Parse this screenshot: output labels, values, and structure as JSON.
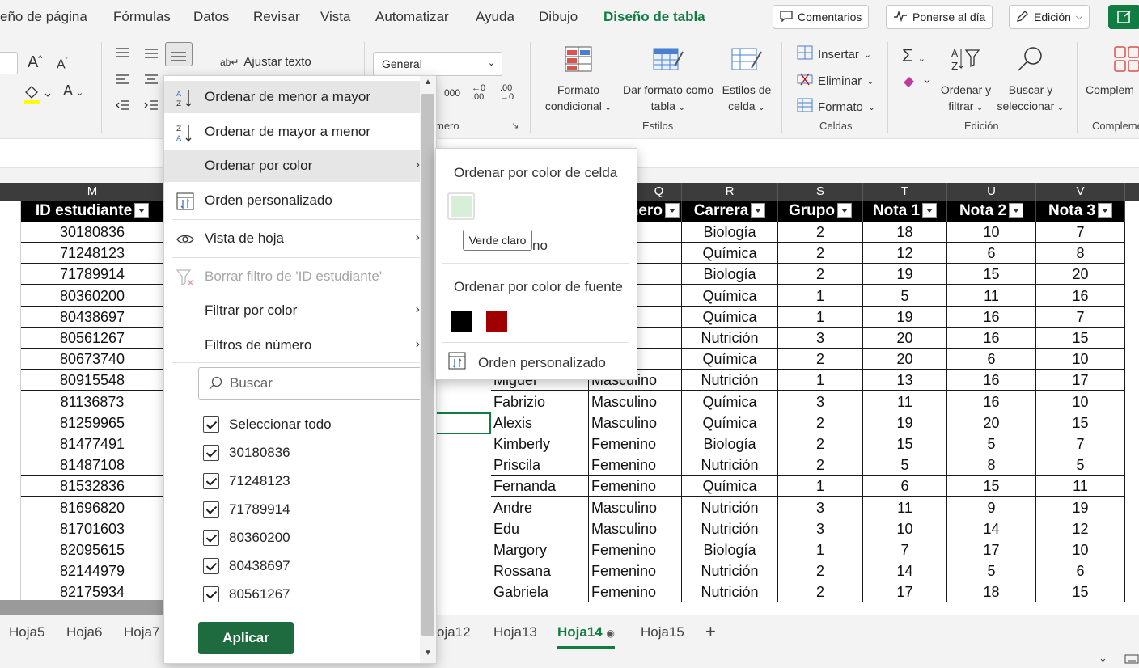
{
  "menu": {
    "tabs": [
      "eño de página",
      "Fórmulas",
      "Datos",
      "Revisar",
      "Vista",
      "Automatizar",
      "Ayuda",
      "Dibujo",
      "Diseño de tabla"
    ],
    "active_tab": "Diseño de tabla",
    "comments": "Comentarios",
    "catch_up": "Ponerse al día",
    "editing": "Edición"
  },
  "ribbon": {
    "wrap_text": "Ajustar texto",
    "number_format": "General",
    "group_numero": "mero",
    "conditional_format": [
      "Formato",
      "condicional"
    ],
    "format_as_table": [
      "Dar formato como",
      "tabla"
    ],
    "cell_styles": [
      "Estilos de",
      "celda"
    ],
    "group_styles": "Estilos",
    "insert": "Insertar",
    "delete": "Eliminar",
    "format": "Formato",
    "group_cells": "Celdas",
    "sort_filter": [
      "Ordenar y",
      "filtrar"
    ],
    "find_select": [
      "Buscar y",
      "seleccionar"
    ],
    "group_edit": "Edición",
    "complements": "Complem",
    "group_complements": "Compleme"
  },
  "grid": {
    "columns": [
      "M",
      "Q",
      "R",
      "S",
      "T",
      "U",
      "V"
    ],
    "headers": {
      "id": "ID estudiante",
      "genero": "nero",
      "carrera": "Carrera",
      "grupo": "Grupo",
      "nota1": "Nota 1",
      "nota2": "Nota 2",
      "nota3": "Nota 3"
    },
    "rows": [
      {
        "id": "30180836",
        "nombre": "",
        "genero": "sculino",
        "carrera": "Biología",
        "grupo": "2",
        "n1": "18",
        "n2": "10",
        "n3": "7"
      },
      {
        "id": "71248123",
        "nombre": "",
        "genero": "sculino",
        "carrera": "Química",
        "grupo": "2",
        "n1": "12",
        "n2": "6",
        "n3": "8"
      },
      {
        "id": "71789914",
        "nombre": "",
        "genero": "sculino",
        "carrera": "Biología",
        "grupo": "2",
        "n1": "19",
        "n2": "15",
        "n3": "20"
      },
      {
        "id": "80360200",
        "nombre": "",
        "genero": "enino",
        "carrera": "Química",
        "grupo": "1",
        "n1": "5",
        "n2": "11",
        "n3": "16"
      },
      {
        "id": "80438697",
        "nombre": "",
        "genero": "enino",
        "carrera": "Química",
        "grupo": "1",
        "n1": "19",
        "n2": "16",
        "n3": "7"
      },
      {
        "id": "80561267",
        "nombre": "",
        "genero": "sculino",
        "carrera": "Nutrición",
        "grupo": "3",
        "n1": "20",
        "n2": "16",
        "n3": "15"
      },
      {
        "id": "80673740",
        "nombre": "",
        "genero": "sculino",
        "carrera": "Química",
        "grupo": "2",
        "n1": "20",
        "n2": "6",
        "n3": "10"
      },
      {
        "id": "80915548",
        "nombre": "Miguel",
        "genero": "Masculino",
        "carrera": "Nutrición",
        "grupo": "1",
        "n1": "13",
        "n2": "16",
        "n3": "17"
      },
      {
        "id": "81136873",
        "nombre": "Fabrizio",
        "genero": "Masculino",
        "carrera": "Química",
        "grupo": "3",
        "n1": "11",
        "n2": "16",
        "n3": "10"
      },
      {
        "id": "81259965",
        "nombre": "Alexis",
        "genero": "Masculino",
        "carrera": "Química",
        "grupo": "2",
        "n1": "19",
        "n2": "20",
        "n3": "15"
      },
      {
        "id": "81477491",
        "nombre": "Kimberly",
        "genero": "Femenino",
        "carrera": "Biología",
        "grupo": "2",
        "n1": "15",
        "n2": "5",
        "n3": "7"
      },
      {
        "id": "81487108",
        "nombre": "Priscila",
        "genero": "Femenino",
        "carrera": "Nutrición",
        "grupo": "2",
        "n1": "5",
        "n2": "8",
        "n3": "5"
      },
      {
        "id": "81532836",
        "nombre": "Fernanda",
        "genero": "Femenino",
        "carrera": "Química",
        "grupo": "1",
        "n1": "6",
        "n2": "15",
        "n3": "11"
      },
      {
        "id": "81696820",
        "nombre": "Andre",
        "genero": "Masculino",
        "carrera": "Nutrición",
        "grupo": "3",
        "n1": "11",
        "n2": "9",
        "n3": "19"
      },
      {
        "id": "81701603",
        "nombre": "Edu",
        "genero": "Masculino",
        "carrera": "Nutrición",
        "grupo": "3",
        "n1": "10",
        "n2": "14",
        "n3": "12"
      },
      {
        "id": "82095615",
        "nombre": "Margory",
        "genero": "Femenino",
        "carrera": "Biología",
        "grupo": "1",
        "n1": "7",
        "n2": "17",
        "n3": "10"
      },
      {
        "id": "82144979",
        "nombre": "Rossana",
        "genero": "Femenino",
        "carrera": "Nutrición",
        "grupo": "2",
        "n1": "14",
        "n2": "5",
        "n3": "6"
      },
      {
        "id": "82175934",
        "nombre": "Gabriela",
        "genero": "Femenino",
        "carrera": "Nutrición",
        "grupo": "2",
        "n1": "17",
        "n2": "18",
        "n3": "15"
      }
    ]
  },
  "sheets": {
    "tabs": [
      "Hoja5",
      "Hoja6",
      "Hoja7",
      "oja12",
      "Hoja13",
      "Hoja14",
      "Hoja15"
    ],
    "active": "Hoja14",
    "add": "+"
  },
  "dropdown": {
    "sort_asc": "Ordenar de menor a mayor",
    "sort_desc": "Ordenar de mayor a menor",
    "sort_color": "Ordenar por color",
    "custom_sort": "Orden personalizado",
    "sheet_view": "Vista de hoja",
    "clear_filter": "Borrar filtro de 'ID estudiante'",
    "filter_color": "Filtrar por color",
    "number_filters": "Filtros de número",
    "search_placeholder": "Buscar",
    "select_all": "Seleccionar todo",
    "values": [
      "30180836",
      "71248123",
      "71789914",
      "80360200",
      "80438697",
      "80561267"
    ],
    "apply": "Aplicar"
  },
  "submenu": {
    "cell_color_title": "Ordenar por color de celda",
    "no_fill_fragment": "no",
    "font_color_title": "Ordenar por color de fuente",
    "custom_sort": "Orden personalizado",
    "tooltip": "Verde claro",
    "cell_swatch_color": "#d6efd6",
    "font_swatch_colors": [
      "#000000",
      "#a00000"
    ]
  },
  "colors": {
    "accent": "#107c41",
    "apply": "#1e6b3f"
  }
}
